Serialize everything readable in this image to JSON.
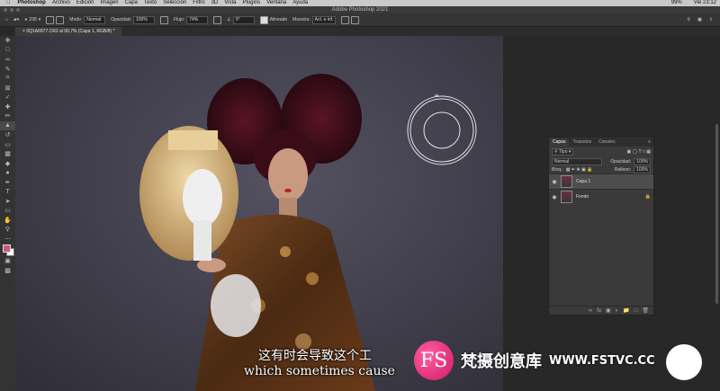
{
  "mac_menu": {
    "app": "Photoshop",
    "items": [
      "Archivo",
      "Edición",
      "Imagen",
      "Capa",
      "Texto",
      "Selección",
      "Filtro",
      "3D",
      "Vista",
      "Plugins",
      "Ventana",
      "Ayuda"
    ],
    "status_right": [
      "99%",
      "Vie 23:12"
    ]
  },
  "window_title": "Adobe Photoshop 2021",
  "options_bar": {
    "brush_size": "238",
    "mode_label": "Modo:",
    "mode_value": "Normal",
    "opacity_label": "Opacidad:",
    "opacity_value": "100%",
    "flow_label": "Flujo:",
    "flow_value": "74%",
    "angle_value": "0°",
    "aligned_label": "Alineado",
    "sample_label": "Muestra:",
    "sample_value": "Act. e inf."
  },
  "document_tab": "0Q1A6977.CR2 al 90,7% (Capa 1, RGB/8) *",
  "layers_panel": {
    "tabs": [
      "Capas",
      "Trazados",
      "Canales"
    ],
    "active_tab": "Capas",
    "filter_label": "Tipo",
    "blend_mode": "Normal",
    "opacity_label": "Opacidad:",
    "opacity_value": "100%",
    "lock_label": "Bloq.:",
    "fill_label": "Relleno:",
    "fill_value": "100%",
    "layers": [
      {
        "name": "Capa 1",
        "selected": true
      },
      {
        "name": "Fondo",
        "selected": false
      }
    ]
  },
  "subtitles": {
    "line_cn": "这有时会导致这个工",
    "line_en": "which sometimes cause"
  },
  "watermark": {
    "logo_text": "FS",
    "name_cn": "梵摄创意库",
    "url": "WWW.FSTVC.CC"
  },
  "colors": {
    "foreground": "#c85a7a",
    "background": "#ffffff",
    "accent": "#d01a6a"
  }
}
